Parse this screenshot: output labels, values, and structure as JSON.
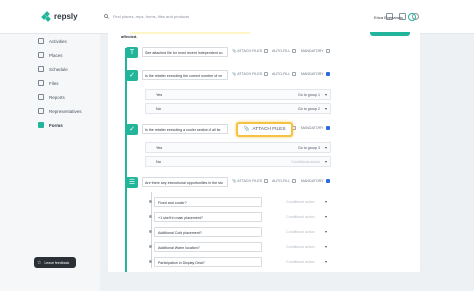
{
  "brand": {
    "name": "repsly",
    "accent": "#23b59b"
  },
  "search": {
    "placeholder": "Find places, reps, forms, files and products"
  },
  "user": {
    "name": "Erica Evenanzio"
  },
  "sidebar": {
    "items": [
      {
        "label": "Activities",
        "icon": "activity-icon"
      },
      {
        "label": "Places",
        "icon": "place-icon"
      },
      {
        "label": "Schedule",
        "icon": "calendar-icon"
      },
      {
        "label": "Files",
        "icon": "file-icon"
      },
      {
        "label": "Reports",
        "icon": "report-icon"
      },
      {
        "label": "Representatives",
        "icon": "people-icon"
      },
      {
        "label": "Forms",
        "icon": "form-icon",
        "active": true
      }
    ],
    "feedback": "Leave feedback"
  },
  "form": {
    "header_text": "affected.",
    "questions": [
      {
        "text": "See attached file for most recent Independent co",
        "attach": "ATTACH FILES",
        "autofill": "AUTO-FILL",
        "mandatory": "MANDATORY",
        "mandatory_checked": false
      },
      {
        "text": "Is the retailer executing the correct number of ve",
        "attach": "ATTACH FILES",
        "autofill": "AUTO-FILL",
        "mandatory": "MANDATORY",
        "mandatory_checked": true
      },
      {
        "text": "Is the retailer executing a cooler section if all tw",
        "attach": "ATTACH FILES",
        "autofill": "AUTO-FILL",
        "mandatory": "MANDATORY",
        "mandatory_checked": true
      },
      {
        "text": "Are there any executional opportunities in the sto",
        "attach": "ATTACH FILES",
        "autofill": "AUTO-FILL",
        "mandatory": "MANDATORY",
        "mandatory_checked": true
      }
    ],
    "answers_q2": [
      {
        "label": "Yes",
        "action": "Go to group 1"
      },
      {
        "label": "No",
        "action": "Go to group 2"
      }
    ],
    "answers_q3": [
      {
        "label": "Yes",
        "action": "Go to group 3"
      },
      {
        "label": "No",
        "action": "Conditional action"
      }
    ],
    "options_q4": [
      {
        "label": "Fixed and cooler?",
        "action": "Conditional action"
      },
      {
        "label": "+1 shelf in main placement?",
        "action": "Conditional action"
      },
      {
        "label": "Additional Cold placement?",
        "action": "Conditional action"
      },
      {
        "label": "Additional Warm location?",
        "action": "Conditional action"
      },
      {
        "label": "Participation in Display Deal?",
        "action": "Conditional action"
      }
    ],
    "callout": "ATTACH FILES"
  }
}
